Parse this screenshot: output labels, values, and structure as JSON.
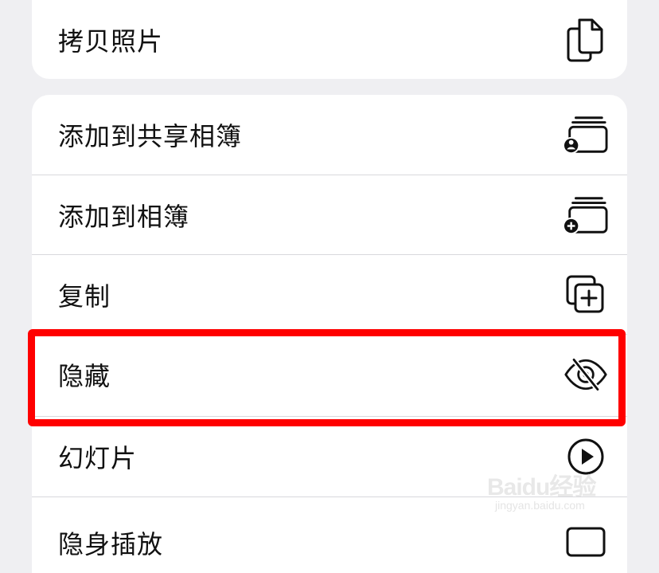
{
  "menu_top": {
    "items": [
      {
        "label": "拷贝照片",
        "icon": "copy-photo-icon"
      }
    ]
  },
  "menu_main": {
    "items": [
      {
        "label": "添加到共享相簿",
        "icon": "shared-album-icon"
      },
      {
        "label": "添加到相簿",
        "icon": "add-to-album-icon"
      },
      {
        "label": "复制",
        "icon": "duplicate-icon"
      },
      {
        "label": "隐藏",
        "icon": "eye-slash-icon"
      },
      {
        "label": "幻灯片",
        "icon": "play-circle-icon"
      },
      {
        "label": "隐身插放",
        "icon": "partial-icon"
      }
    ]
  },
  "highlight": {
    "color": "#ff0000",
    "target": "隐藏"
  },
  "watermark": {
    "main": "Baidu经验",
    "sub": "jingyan.baidu.com"
  }
}
